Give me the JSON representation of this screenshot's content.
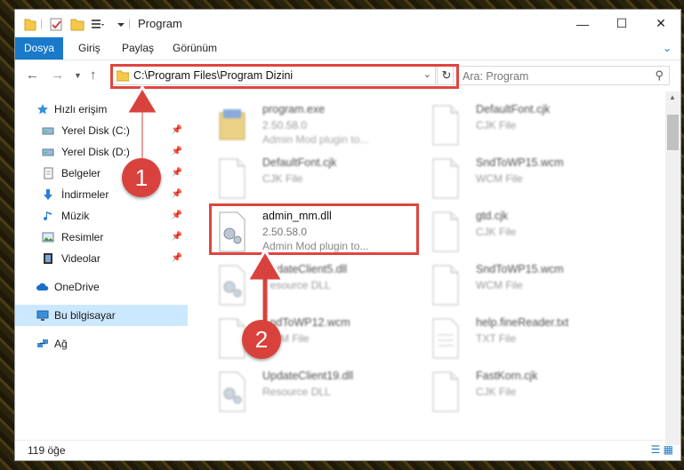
{
  "window": {
    "title": "Program"
  },
  "quick_access_icons": [
    "folder-icon",
    "properties-icon",
    "new-folder-icon",
    "customize-icon"
  ],
  "window_controls": [
    "minimize-icon",
    "maximize-icon",
    "close-icon"
  ],
  "ribbon": {
    "tabs": [
      "Dosya",
      "Giriş",
      "Paylaş",
      "Görünüm"
    ]
  },
  "address": {
    "path": "C:\\Program Files\\Program Dizini"
  },
  "search": {
    "placeholder": "Ara: Program"
  },
  "sidebar": {
    "items": [
      {
        "label": "Hızlı erişim",
        "icon": "star-icon"
      },
      {
        "label": "Yerel Disk (C:)",
        "icon": "drive-icon",
        "pinned": true
      },
      {
        "label": "Yerel Disk (D:)",
        "icon": "drive-icon",
        "pinned": true
      },
      {
        "label": "Belgeler",
        "icon": "documents-icon",
        "pinned": true
      },
      {
        "label": "İndirmeler",
        "icon": "downloads-icon",
        "pinned": true
      },
      {
        "label": "Müzik",
        "icon": "music-icon",
        "pinned": true
      },
      {
        "label": "Resimler",
        "icon": "pictures-icon",
        "pinned": true
      },
      {
        "label": "Videolar",
        "icon": "videos-icon",
        "pinned": true
      },
      {
        "label": "OneDrive",
        "icon": "cloud-icon"
      },
      {
        "label": "Bu bilgisayar",
        "icon": "computer-icon",
        "selected": true
      },
      {
        "label": "Ağ",
        "icon": "network-icon"
      }
    ]
  },
  "files": [
    {
      "name": "program.exe",
      "line1": "2.50.58.0",
      "line2": "Admin Mod plugin to..."
    },
    {
      "name": "DefaultFont.cjk",
      "line1": "CJK File"
    },
    {
      "name": "DefaultFont.cjk",
      "line1": "CJK File"
    },
    {
      "name": "SndToWP15.wcm",
      "line1": "WCM File"
    },
    {
      "name": "admin_mm.dll",
      "line1": "2.50.58.0",
      "line2": "Admin Mod plugin to...",
      "highlighted": true
    },
    {
      "name": "gtd.cjk",
      "line1": "CJK File"
    },
    {
      "name": "UpdateClient5.dll",
      "line1": "Resource DLL"
    },
    {
      "name": "SndToWP15.wcm",
      "line1": "WCM File"
    },
    {
      "name": "SndToWP12.wcm",
      "line1": "WCM File"
    },
    {
      "name": "help.fineReader.txt",
      "line1": "TXT File"
    },
    {
      "name": "UpdateClient19.dll",
      "line1": "Resource DLL"
    },
    {
      "name": "FastKorn.cjk",
      "line1": "CJK File"
    }
  ],
  "status": {
    "count": "119 öğe"
  },
  "callouts": [
    "1",
    "2"
  ],
  "colors": {
    "accent": "#1979ca",
    "highlight": "#e0453f",
    "selected": "#cce8ff"
  }
}
